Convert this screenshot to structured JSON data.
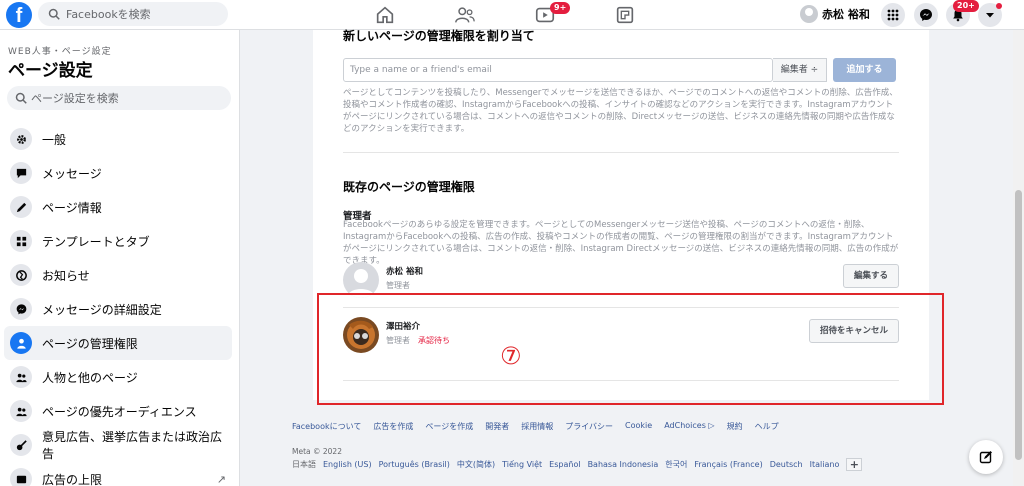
{
  "topbar": {
    "logo": "f",
    "search_placeholder": "Facebookを検索",
    "video_badge": "9+",
    "user_name": "赤松 裕和",
    "notif_badge": "20+",
    "icons": [
      "home-icon",
      "friends-icon",
      "watch-icon",
      "gaming-icon",
      "menu-grid-icon",
      "messenger-icon",
      "bell-icon",
      "caret-down-icon"
    ]
  },
  "sidebar": {
    "breadcrumb": "WEB人事・ページ設定",
    "title": "ページ設定",
    "search_placeholder": "ページ設定を検索",
    "items": [
      {
        "label": "一般",
        "icon": "gear-icon"
      },
      {
        "label": "メッセージ",
        "icon": "chat-icon"
      },
      {
        "label": "ページ情報",
        "icon": "pencil-icon"
      },
      {
        "label": "テンプレートとタブ",
        "icon": "grid-icon"
      },
      {
        "label": "お知らせ",
        "icon": "globe-icon"
      },
      {
        "label": "メッセージの詳細設定",
        "icon": "messenger-icon"
      },
      {
        "label": "ページの管理権限",
        "icon": "person-icon",
        "active": true
      },
      {
        "label": "人物と他のページ",
        "icon": "people-icon"
      },
      {
        "label": "ページの優先オーディエンス",
        "icon": "people-icon"
      },
      {
        "label": "意見広告、選挙広告または政治広告",
        "icon": "guitar-icon"
      },
      {
        "label": "広告の上限",
        "icon": "ad-icon"
      }
    ]
  },
  "assign": {
    "title": "新しいページの管理権限を割り当て",
    "input_placeholder": "Type a name or a friend's email",
    "role_select": "編集者 ÷",
    "add_button": "追加する",
    "description": "ページとしてコンテンツを投稿したり、Messengerでメッセージを送信できるほか、ページでのコメントへの返信やコメントの削除、広告作成、投稿やコメント作成者の確認、InstagramからFacebookへの投稿、インサイトの確認などのアクションを実行できます。Instagramアカウントがページにリンクされている場合は、コメントへの返信やコメントの削除、Directメッセージの送信、ビジネスの連絡先情報の同期や広告作成などのアクションを実行できます。"
  },
  "existing": {
    "title": "既存のページの管理権限",
    "admin_label": "管理者",
    "admin_description": "Facebookページのあらゆる設定を管理できます。ページとしてのMessengerメッセージ送信や投稿、ページのコメントへの返信・削除、InstagramからFacebookへの投稿、広告の作成、投稿やコメントの作成者の閲覧、ページの管理権限の割当ができます。Instagramアカウントがページにリンクされている場合は、コメントの返信・削除、Instagram Directメッセージの送信、ビジネスの連絡先情報の同期、広告の作成ができます。",
    "people": [
      {
        "name": "赤松 裕和",
        "role": "管理者",
        "pending": "",
        "button": "編集する"
      },
      {
        "name": "澤田裕介",
        "role": "管理者",
        "pending": "承認待ち",
        "button": "招待をキャンセル"
      }
    ]
  },
  "annotation": {
    "marker": "⑦",
    "color": "#e0262a"
  },
  "footer": {
    "links": [
      "Facebookについて",
      "広告を作成",
      "ページを作成",
      "開発者",
      "採用情報",
      "プライバシー",
      "Cookie",
      "AdChoices ▷",
      "規約",
      "ヘルプ"
    ],
    "meta": "Meta © 2022",
    "languages": [
      "日本語",
      "English (US)",
      "Português (Brasil)",
      "中文(简体)",
      "Tiếng Việt",
      "Español",
      "Bahasa Indonesia",
      "한국어",
      "Français (France)",
      "Deutsch",
      "Italiano"
    ],
    "more_button": "+"
  },
  "colors": {
    "accent": "#1877f2",
    "badge": "#e41e3f",
    "annotation": "#e0262a"
  }
}
